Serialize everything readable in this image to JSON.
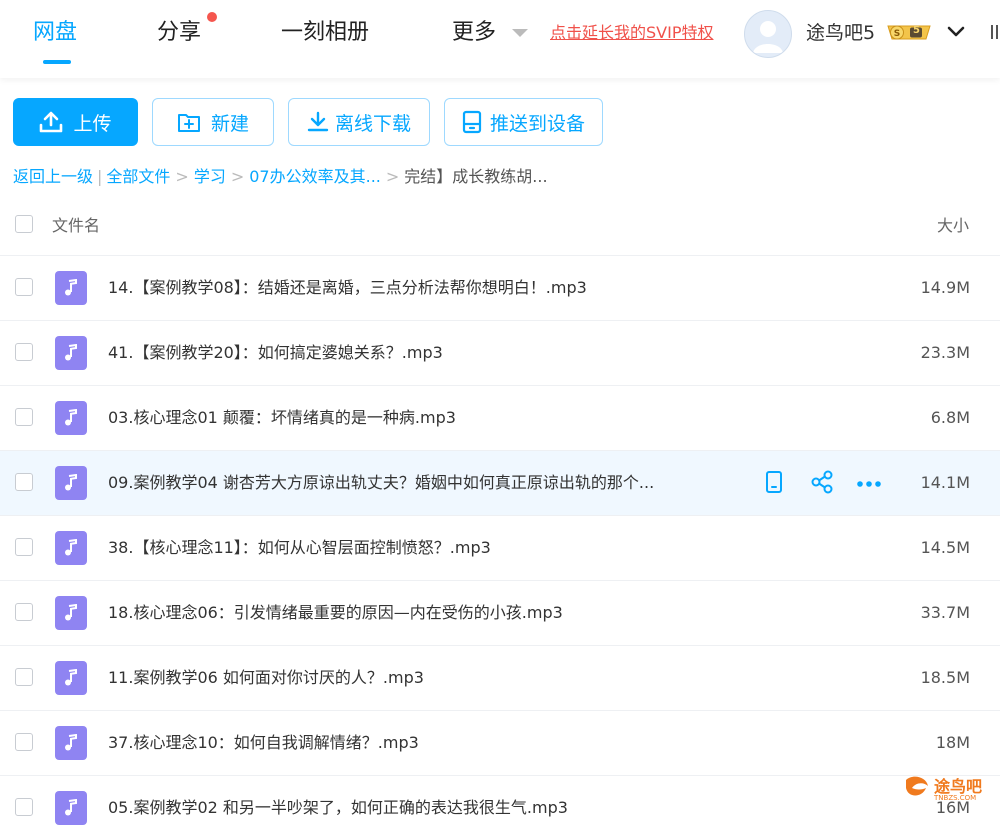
{
  "header": {
    "nav": {
      "netdisk": "网盘",
      "share": "分享",
      "album": "一刻相册",
      "more": "更多"
    },
    "svip_link": "点击延长我的SVIP特权",
    "username": "途鸟吧5",
    "badge_level": "5",
    "accent_color": "#06a7ff"
  },
  "toolbar": {
    "upload": "上传",
    "new": "新建",
    "offline_download": "离线下载",
    "push_to_device": "推送到设备"
  },
  "breadcrumb": {
    "back": "返回上一级",
    "all_files": "全部文件",
    "study": "学习",
    "folder_07": "07办公效率及其...",
    "current": "完结】成长教练胡..."
  },
  "table": {
    "col_name": "文件名",
    "col_size": "大小",
    "rows": [
      {
        "name": "14.【案例教学08】：结婚还是离婚，三点分析法帮你想明白！.mp3",
        "size": "14.9M"
      },
      {
        "name": "41.【案例教学20】：如何搞定婆媳关系？.mp3",
        "size": "23.3M"
      },
      {
        "name": "03.核心理念01 颠覆：坏情绪真的是一种病.mp3",
        "size": "6.8M"
      },
      {
        "name": "09.案例教学04 谢杏芳大方原谅出轨丈夫？婚姻中如何真正原谅出轨的那个...",
        "size": "14.1M"
      },
      {
        "name": "38.【核心理念11】：如何从心智层面控制愤怒？.mp3",
        "size": "14.5M"
      },
      {
        "name": "18.核心理念06：引发情绪最重要的原因—内在受伤的小孩.mp3",
        "size": "33.7M"
      },
      {
        "name": "11.案例教学06 如何面对你讨厌的人？.mp3",
        "size": "18.5M"
      },
      {
        "name": "37.核心理念10：如何自我调解情绪？.mp3",
        "size": "18M"
      },
      {
        "name": "05.案例教学02 和另一半吵架了，如何正确的表达我很生气.mp3",
        "size": "16M"
      }
    ]
  },
  "watermark": {
    "text": "途鸟吧",
    "sub": "TNBZS.COM"
  }
}
